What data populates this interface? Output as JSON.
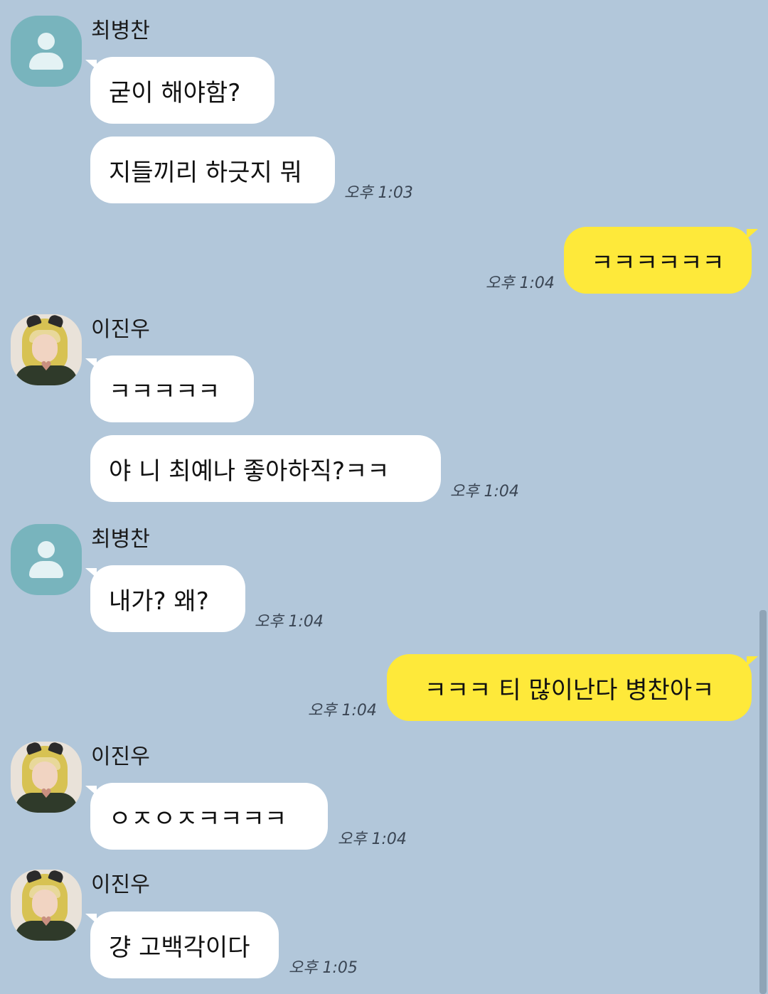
{
  "senders": {
    "choi": "최병찬",
    "lee": "이진우"
  },
  "messages": {
    "m1": "굳이 해야함?",
    "m2": "지들끼리 하긋지 뭐",
    "m3": "ㅋㅋㅋㅋㅋㅋ",
    "m4": "ㅋㅋㅋㅋㅋ",
    "m5": "야 니 최예나 좋아하직?ㅋㅋ",
    "m6": "내가? 왜?",
    "m7": "ㅋㅋㅋ 티 많이난다 병찬아ㅋ",
    "m8": "ㅇㅈㅇㅈㅋㅋㅋㅋ",
    "m9": "걍 고백각이다"
  },
  "times": {
    "t1": "오후 1:03",
    "t2": "오후 1:04",
    "t3": "오후 1:04",
    "t4": "오후 1:04",
    "t5": "오후 1:04",
    "t6": "오후 1:04",
    "t7": "오후 1:05"
  },
  "colors": {
    "background": "#b2c7da",
    "incoming_bubble": "#ffffff",
    "outgoing_bubble": "#fee93a",
    "default_avatar": "#78b4bd"
  },
  "icons": {
    "default_avatar": "person-icon"
  }
}
